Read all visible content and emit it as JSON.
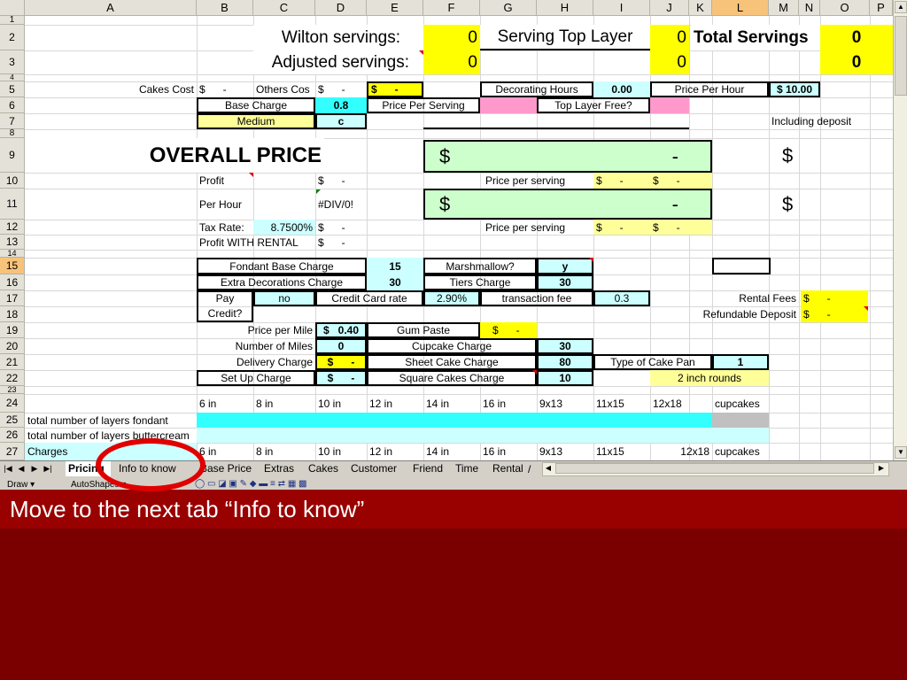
{
  "caption": "Move to the next tab “Info to know”",
  "columns": [
    "A",
    "B",
    "C",
    "D",
    "E",
    "F",
    "G",
    "H",
    "I",
    "J",
    "K",
    "L",
    "M",
    "N",
    "O",
    "P"
  ],
  "rows": [
    "1",
    "2",
    "3",
    "4",
    "5",
    "6",
    "7",
    "8",
    "9",
    "10",
    "11",
    "12",
    "13",
    "14",
    "15",
    "16",
    "17",
    "18",
    "19",
    "20",
    "21",
    "22",
    "23",
    "24",
    "25",
    "26",
    "27"
  ],
  "cells": {
    "wilton_label": "Wilton servings:",
    "wilton_value": "0",
    "serving_top_label": "Serving Top Layer",
    "serving_top_value": "0",
    "total_servings_label": "Total Servings",
    "total_servings_value": "0",
    "adjusted_label": "Adjusted servings:",
    "adjusted_value": "0",
    "adjusted_j": "0",
    "adjusted_o": "0",
    "cakes_cost_label": "Cakes Cost",
    "cakes_cost_value": "$      -",
    "others_cost_label": "Others Cos",
    "others_cost_value": "$      -",
    "e5_value": "$      -",
    "decorating_hours_label": "Decorating Hours",
    "decorating_hours_value": "0.00",
    "price_per_hour_label": "Price Per Hour",
    "price_per_hour_value": "$ 10.00",
    "base_charge_label": "Base Charge",
    "base_charge_value": "0.8",
    "price_per_serving_label": "Price Per Serving",
    "top_layer_free_label": "Top Layer Free?",
    "medium_label": "Medium",
    "medium_code": "c",
    "including_deposit": "Including deposit",
    "overall_price": "OVERALL PRICE",
    "dollar_sign": "$",
    "dash": "-",
    "profit_label": "Profit",
    "profit_value": "$      -",
    "price_per_serving_10": "Price per serving",
    "pps_h10": "$      -",
    "pps_i10": "$      -",
    "per_hour_label": "Per Hour",
    "per_hour_value": "#DIV/0!",
    "tax_rate_label": "Tax Rate:",
    "tax_rate_value": "8.7500%",
    "tax_value": "$      -",
    "pps_h12": "$      -",
    "pps_i12": "$      -",
    "profit_rental_label": "Profit WITH RENTAL",
    "profit_rental_value": "$      -",
    "fondant_base_label": "Fondant Base Charge",
    "fondant_base_value": "15",
    "marshmallow_label": "Marshmallow?",
    "marshmallow_value": "y",
    "extra_decor_label": "Extra Decorations Charge",
    "extra_decor_value": "30",
    "tiers_charge_label": "Tiers Charge",
    "tiers_charge_value": "30",
    "pay_label": "Pay",
    "credit_label": "Credit?",
    "pay_value": "no",
    "cc_rate_label": "Credit Card rate",
    "cc_rate_value": "2.90%",
    "transaction_fee_label": "transaction fee",
    "transaction_fee_value": "0.3",
    "rental_fees_label": "Rental Fees",
    "rental_fees_value": "$      -",
    "refundable_label": "Refundable Deposit",
    "refundable_value": "$      -",
    "price_per_mile_label": "Price per Mile",
    "price_per_mile_value": "$   0.40",
    "gum_paste_label": "Gum Paste",
    "gum_paste_value": "$      -",
    "miles_label": "Number of Miles",
    "miles_value": "0",
    "cupcake_charge_label": "Cupcake Charge",
    "cupcake_charge_value": "30",
    "delivery_label": "Delivery Charge",
    "delivery_value": "$      -",
    "sheet_cake_label": "Sheet Cake Charge",
    "sheet_cake_value": "80",
    "type_pan_label": "Type of Cake Pan",
    "type_pan_value": "1",
    "setup_label": "Set Up Charge",
    "setup_value": "$      -",
    "square_cakes_label": "Square Cakes Charge",
    "square_cakes_value": "10",
    "two_inch_rounds": "2 inch rounds",
    "sizes": [
      "6 in",
      "8 in",
      "10 in",
      "12 in",
      "14 in",
      "16 in",
      "9x13",
      "11x15",
      "12x18",
      "cupcakes"
    ],
    "layers_fondant": "total number of layers fondant",
    "layers_buttercream": "total number of layers buttercream",
    "charges": "Charges"
  },
  "sheet_tabs": [
    "Pricing",
    "Info to know",
    "Base Price",
    "Extras",
    "Cakes",
    "Customer",
    "Friend",
    "Time",
    "Rental"
  ],
  "active_tab": "Pricing",
  "draw_toolbar": {
    "draw": "Draw ▾",
    "autoshapes": "AutoShapes ▾"
  }
}
